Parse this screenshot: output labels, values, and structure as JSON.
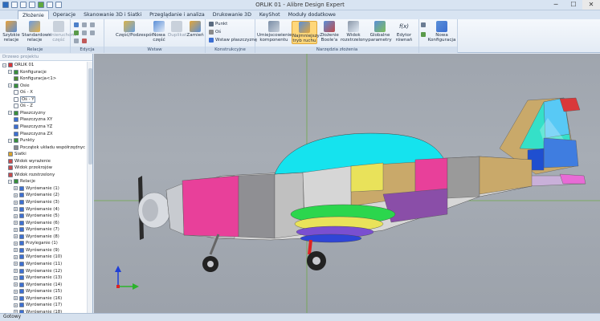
{
  "window": {
    "title": "ORLIK 01 - Alibre Design Expert",
    "minimize": "─",
    "maximize": "☐",
    "close": "✕"
  },
  "tabs": [
    "Złożenie",
    "Operacje",
    "Skanowanie 3D i Siatki",
    "Przeglądanie i analiza",
    "Drukowanie 3D",
    "KeyShot",
    "Moduły dodatkowe"
  ],
  "ribbon": {
    "relacje": {
      "label": "Relacje",
      "szybkie": "Szybkie relacje",
      "standardowe": "Standardowe relacje",
      "unieruchom": "Unieruchom część"
    },
    "edycja": {
      "label": "Edycja"
    },
    "wstaw": {
      "label": "Wstaw",
      "czesc": "Część/Podzespół",
      "nowa": "Nowa część",
      "duplikat": "Duplikat",
      "zamien": "Zamień"
    },
    "konstrukcyjne": {
      "label": "Konstrukcyjne",
      "punkt": "Punkt",
      "os": "Oś",
      "plaszczyzna": "Wstaw płaszczyznę"
    },
    "narzedzia": {
      "label": "Narzędzia złożenia",
      "umiejscowienie": "Umiejscowienie komponentu",
      "najmniejszy": "Najmniejszy tryb ruchu",
      "boole": "Złożenie Boole'a",
      "rozstrzelony": "Widok rozstrzelony",
      "globalne": "Globalne parametry",
      "edytor": "Edytor równań",
      "fx": "f(x)"
    },
    "konfig": {
      "nowa": "Nowa Konfiguracja"
    }
  },
  "panel": {
    "header": "Drzewo projektu"
  },
  "tree": [
    {
      "label": "ORLIK 01",
      "level": 0,
      "expander": "−",
      "icon": "#d8383a"
    },
    {
      "label": "Konfiguracje",
      "level": 1,
      "expander": "−",
      "icon": "#3a8f3a"
    },
    {
      "label": "Konfiguracja<1>",
      "level": 2,
      "expander": "",
      "icon": "#4f8a2e"
    },
    {
      "label": "Osie",
      "level": 1,
      "expander": "−",
      "icon": "#3a8f3a"
    },
    {
      "label": "Oś - X",
      "level": 2,
      "expander": "",
      "icon": "#ffffff"
    },
    {
      "label": "Oś - Y",
      "level": 2,
      "expander": "",
      "icon": "#ffffff"
    },
    {
      "label": "Oś - Z",
      "level": 2,
      "expander": "",
      "icon": "#ffffff"
    },
    {
      "label": "Płaszczyzny",
      "level": 1,
      "expander": "−",
      "icon": "#3a8f3a"
    },
    {
      "label": "Płaszczyzna XY",
      "level": 2,
      "expander": "",
      "icon": "#3d6fd1"
    },
    {
      "label": "Płaszczyzna YZ",
      "level": 2,
      "expander": "",
      "icon": "#3d6fd1"
    },
    {
      "label": "Płaszczyzna ZX",
      "level": 2,
      "expander": "",
      "icon": "#3d6fd1"
    },
    {
      "label": "Punkty",
      "level": 1,
      "expander": "−",
      "icon": "#3a8f3a"
    },
    {
      "label": "Początek układu współrzędnyc",
      "level": 2,
      "expander": "",
      "icon": "#8a8a8a"
    },
    {
      "label": "Siatki",
      "level": 1,
      "expander": "",
      "icon": "#d9a22c"
    },
    {
      "label": "Widok wyrażenie",
      "level": 1,
      "expander": "",
      "icon": "#c44c4c"
    },
    {
      "label": "Widok przekrojów",
      "level": 1,
      "expander": "",
      "icon": "#c44c4c"
    },
    {
      "label": "Widok rozstrzelony",
      "level": 1,
      "expander": "",
      "icon": "#c44c4c"
    },
    {
      "label": "Relacje",
      "level": 1,
      "expander": "−",
      "icon": "#3a8f3a"
    },
    {
      "label": "Wyrównanie (1)",
      "level": 2,
      "expander": "+",
      "icon": "#3d6fd1"
    },
    {
      "label": "Wyrównanie (2)",
      "level": 2,
      "expander": "+",
      "icon": "#3d6fd1"
    },
    {
      "label": "Wyrównanie (3)",
      "level": 2,
      "expander": "+",
      "icon": "#3d6fd1"
    },
    {
      "label": "Wyrównanie (4)",
      "level": 2,
      "expander": "+",
      "icon": "#3d6fd1"
    },
    {
      "label": "Wyrównanie (5)",
      "level": 2,
      "expander": "+",
      "icon": "#3d6fd1"
    },
    {
      "label": "Wyrównanie (6)",
      "level": 2,
      "expander": "+",
      "icon": "#3d6fd1"
    },
    {
      "label": "Wyrównanie (7)",
      "level": 2,
      "expander": "+",
      "icon": "#3d6fd1"
    },
    {
      "label": "Wyrównanie (8)",
      "level": 2,
      "expander": "+",
      "icon": "#3d6fd1"
    },
    {
      "label": "Przyleganie (1)",
      "level": 2,
      "expander": "+",
      "icon": "#3d6fd1"
    },
    {
      "label": "Wyrównanie (9)",
      "level": 2,
      "expander": "+",
      "icon": "#3d6fd1"
    },
    {
      "label": "Wyrównanie (10)",
      "level": 2,
      "expander": "+",
      "icon": "#3d6fd1"
    },
    {
      "label": "Wyrównanie (11)",
      "level": 2,
      "expander": "+",
      "icon": "#3d6fd1"
    },
    {
      "label": "Wyrównanie (12)",
      "level": 2,
      "expander": "+",
      "icon": "#3d6fd1"
    },
    {
      "label": "Wyrównanie (13)",
      "level": 2,
      "expander": "+",
      "icon": "#3d6fd1"
    },
    {
      "label": "Wyrównanie (14)",
      "level": 2,
      "expander": "+",
      "icon": "#3d6fd1"
    },
    {
      "label": "Wyrównanie (15)",
      "level": 2,
      "expander": "+",
      "icon": "#3d6fd1"
    },
    {
      "label": "Wyrównanie (16)",
      "level": 2,
      "expander": "+",
      "icon": "#3d6fd1"
    },
    {
      "label": "Wyrównanie (17)",
      "level": 2,
      "expander": "+",
      "icon": "#3d6fd1"
    },
    {
      "label": "Wyrównanie (18)",
      "level": 2,
      "expander": "+",
      "icon": "#3d6fd1"
    },
    {
      "label": "Wyrównanie (19)",
      "level": 2,
      "expander": "+",
      "icon": "#3d6fd1"
    }
  ],
  "status": {
    "text": "Gotowy"
  },
  "colors": {
    "accent": "#2a62b8",
    "viewport_bg": "#a3a9b1",
    "ribbon_selected": "#ffd77a"
  }
}
